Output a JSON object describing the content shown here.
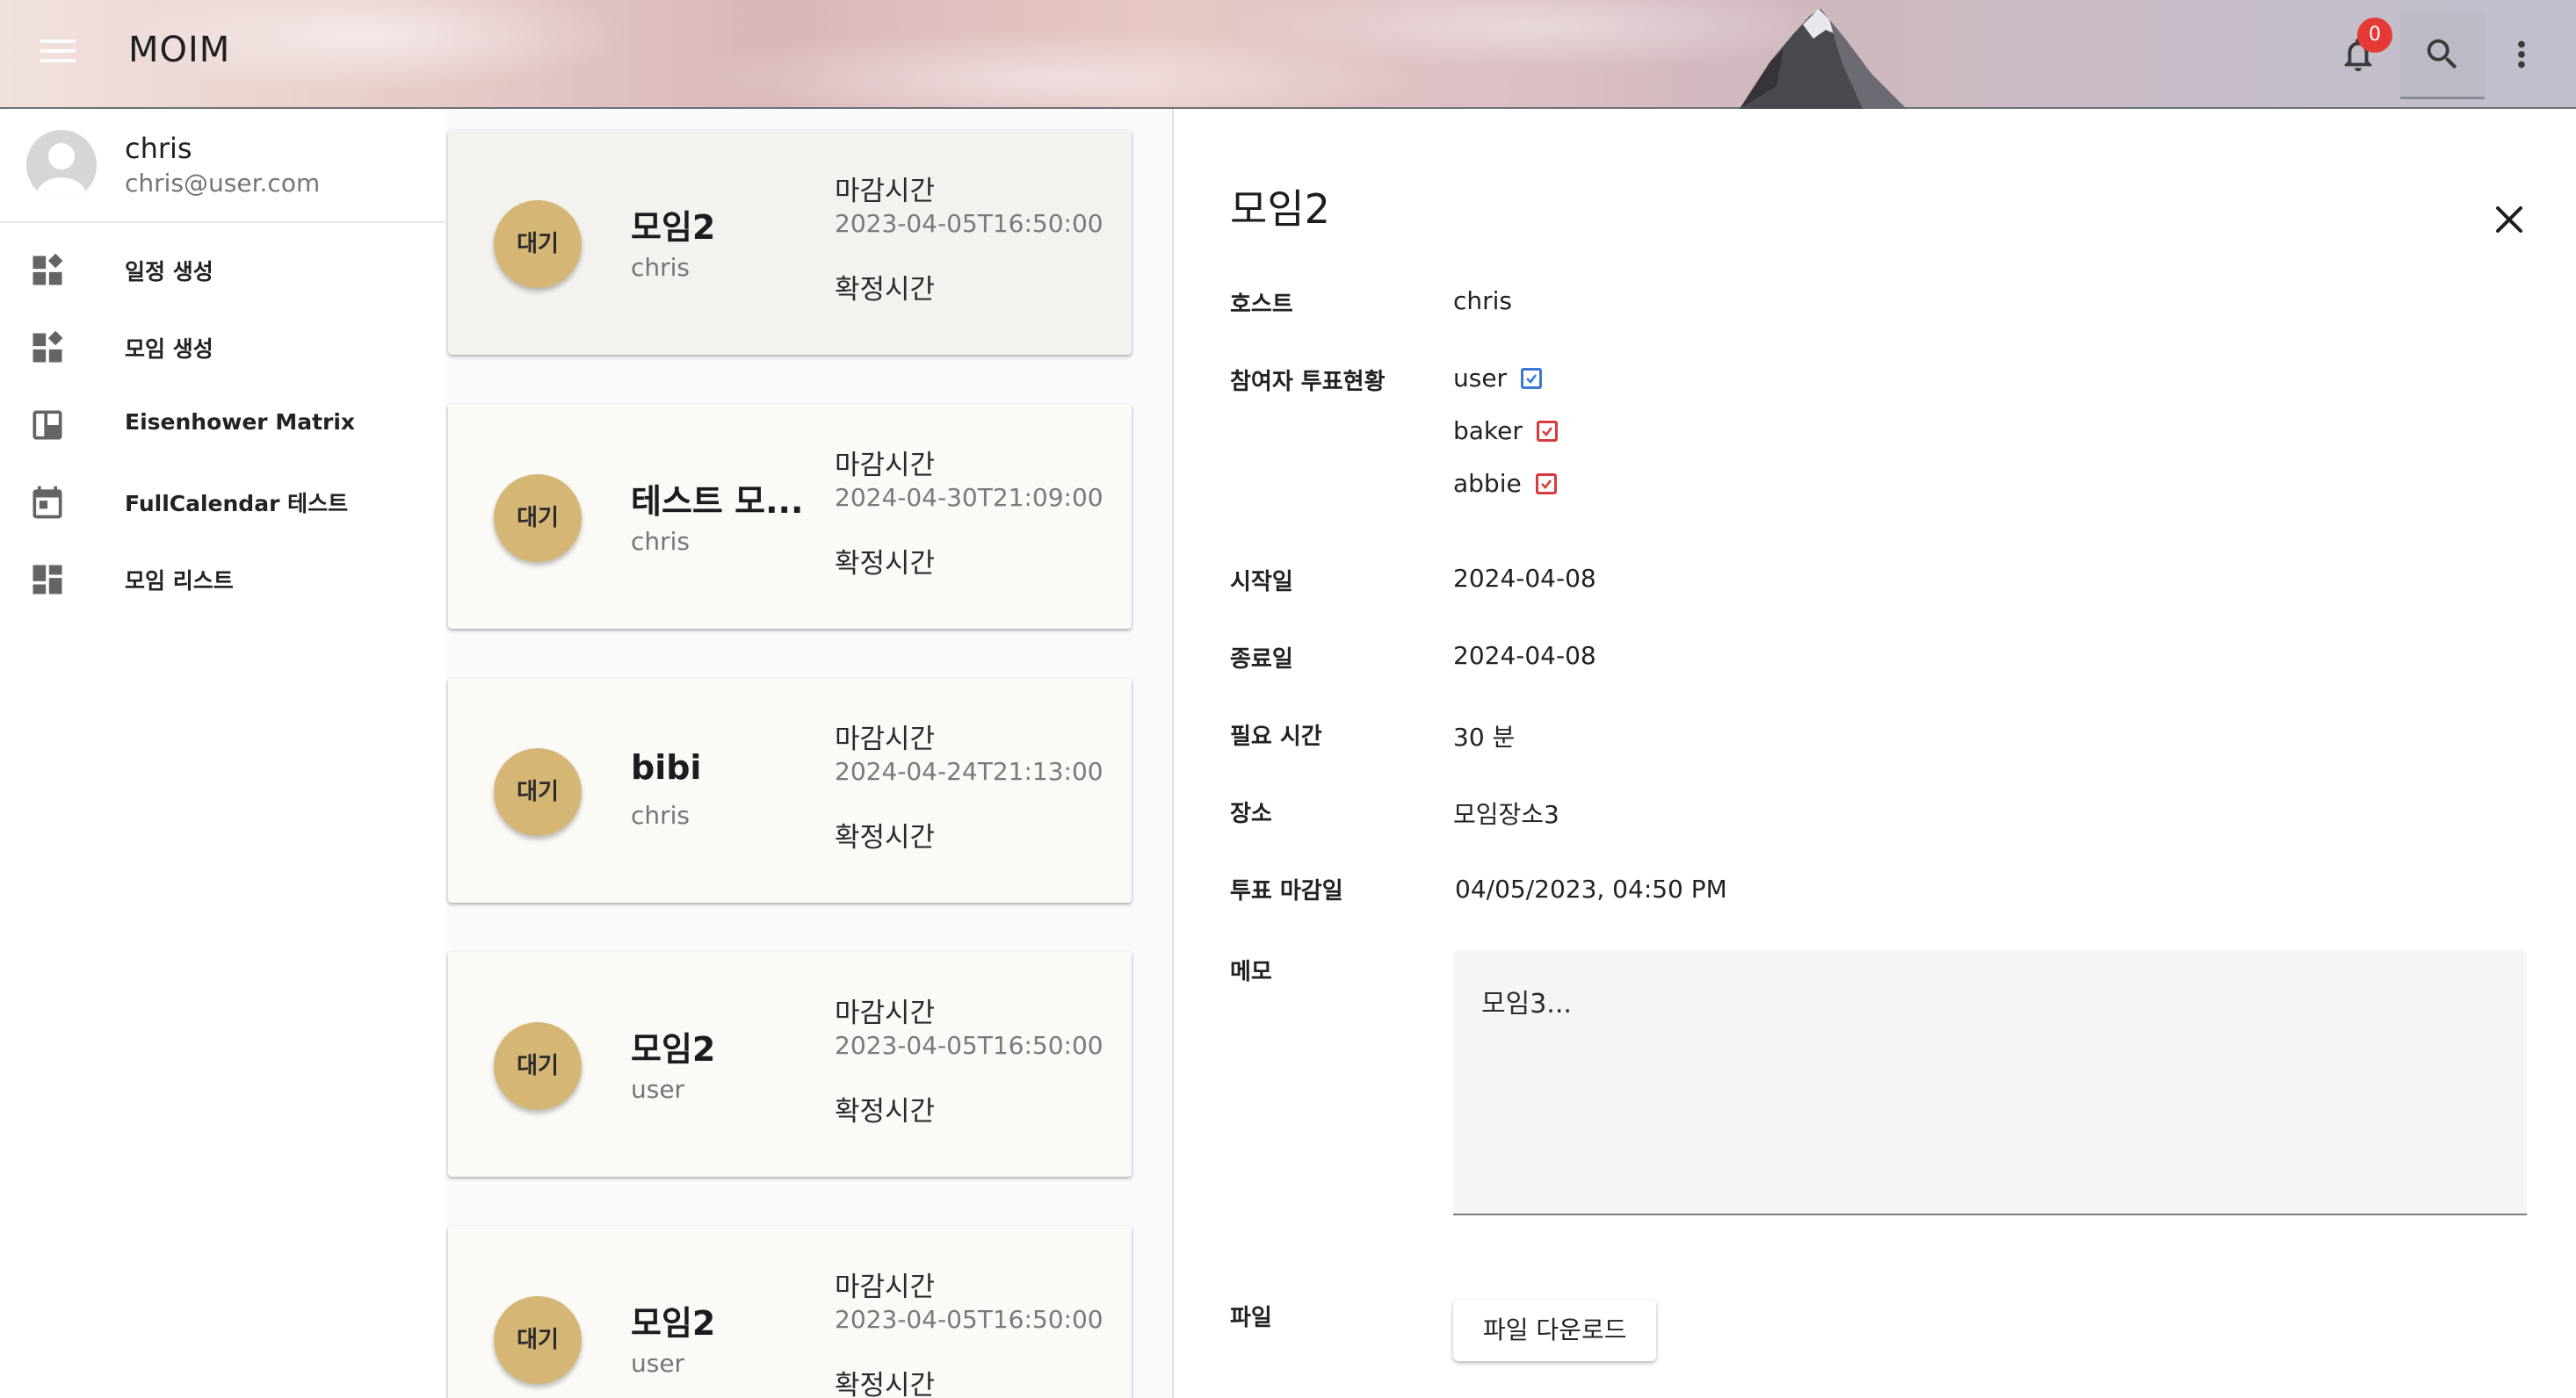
{
  "app": {
    "title": "MOIM",
    "notification_count": "0",
    "icons": {
      "menu": "menu-icon",
      "bell": "bell-icon",
      "search": "search-icon",
      "more": "more-vert-icon"
    }
  },
  "user": {
    "name": "chris",
    "email": "chris@user.com"
  },
  "nav": {
    "items": [
      {
        "label": "일정 생성",
        "icon": "dashboard-customize-icon"
      },
      {
        "label": "모임 생성",
        "icon": "dashboard-customize-icon"
      },
      {
        "label": "Eisenhower Matrix",
        "icon": "board-icon"
      },
      {
        "label": "FullCalendar 테스트",
        "icon": "calendar-icon"
      },
      {
        "label": "모임 리스트",
        "icon": "dashboard-icon"
      }
    ]
  },
  "list": {
    "cards": [
      {
        "status": "대기",
        "title": "모임2",
        "host": "chris",
        "deadline_label": "마감시간",
        "deadline": "2023-04-05T16:50:00",
        "confirm_label": "확정시간",
        "selected": true
      },
      {
        "status": "대기",
        "title": "테스트 모...",
        "host": "chris",
        "deadline_label": "마감시간",
        "deadline": "2024-04-30T21:09:00",
        "confirm_label": "확정시간",
        "selected": false
      },
      {
        "status": "대기",
        "title": "bibi",
        "host": "chris",
        "deadline_label": "마감시간",
        "deadline": "2024-04-24T21:13:00",
        "confirm_label": "확정시간",
        "selected": false
      },
      {
        "status": "대기",
        "title": "모임2",
        "host": "user",
        "deadline_label": "마감시간",
        "deadline": "2023-04-05T16:50:00",
        "confirm_label": "확정시간",
        "selected": false
      },
      {
        "status": "대기",
        "title": "모임2",
        "host": "user",
        "deadline_label": "마감시간",
        "deadline": "2023-04-05T16:50:00",
        "confirm_label": "확정시간",
        "selected": false
      }
    ]
  },
  "detail": {
    "title": "모임2",
    "host_label": "호스트",
    "host": "chris",
    "votes_label": "참여자 투표현황",
    "voters": [
      {
        "name": "user",
        "checkbox_color": "#3b78d8"
      },
      {
        "name": "baker",
        "checkbox_color": "#d83b3b"
      },
      {
        "name": "abbie",
        "checkbox_color": "#d83b3b"
      }
    ],
    "start_label": "시작일",
    "start": "2024-04-08",
    "end_label": "종료일",
    "end": "2024-04-08",
    "duration_label": "필요 시간",
    "duration": "30 분",
    "place_label": "장소",
    "place": "모임장소3",
    "vote_deadline_label": "투표 마감일",
    "vote_deadline": "04/05/2023, 04:50 PM",
    "memo_label": "메모",
    "memo": "모임3...",
    "file_label": "파일",
    "download_label": "파일 다운로드"
  },
  "colors": {
    "status_chip": "#d6b675",
    "badge": "#e53935",
    "accent_blue": "#3b78d8",
    "accent_red": "#d83b3b"
  }
}
